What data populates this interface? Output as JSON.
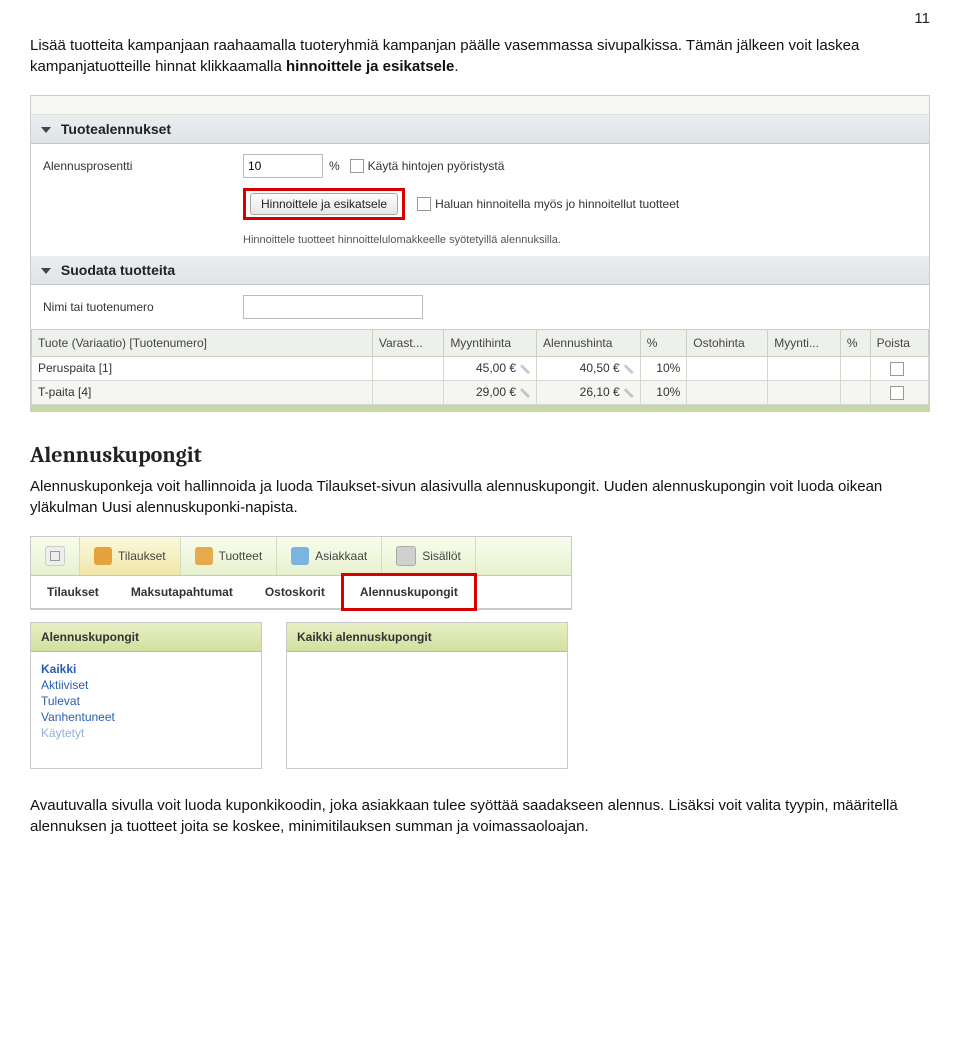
{
  "pageNumber": "11",
  "intro": {
    "line1": "Lisää tuotteita kampanjaan raahaamalla tuoteryhmiä kampanjan päälle vasemmassa sivupalkissa. Tämän jälkeen voit laskea kampanjatuotteille hinnat klikkaamalla ",
    "bold": "hinnoittele ja esikatsele",
    "after": "."
  },
  "panel1": {
    "tuotealennukset": "Tuotealennukset",
    "alennusprosentti_label": "Alennusprosentti",
    "alennusprosentti_value": "10",
    "prosentti": "%",
    "pyoristys": "Käytä hintojen pyöristystä",
    "hinnoittele_btn": "Hinnoittele ja esikatsele",
    "haluan": "Haluan hinnoitella myös jo hinnoitellut tuotteet",
    "hint": "Hinnoittele tuotteet hinnoittelulomakkeelle syötetyillä alennuksilla.",
    "suodata": "Suodata tuotteita",
    "nimi_label": "Nimi tai tuotenumero"
  },
  "table": {
    "h_tuote": "Tuote (Variaatio) [Tuotenumero]",
    "h_varast": "Varast...",
    "h_myyntihinta": "Myyntihinta",
    "h_alennushinta": "Alennushinta",
    "h_pct": "%",
    "h_ostohinta": "Ostohinta",
    "h_myynti": "Myynti...",
    "h_pct2": "%",
    "h_poista": "Poista",
    "rows": [
      {
        "name": "Peruspaita [1]",
        "myyntihinta": "45,00 €",
        "alennushinta": "40,50 €",
        "pct": "10%"
      },
      {
        "name": "T-paita [4]",
        "myyntihinta": "29,00 €",
        "alennushinta": "26,10 €",
        "pct": "10%"
      }
    ]
  },
  "sectionHeading": "Alennuskupongit",
  "sectionPara": "Alennuskuponkeja voit hallinnoida ja luoda Tilaukset-sivun alasivulla alennuskupongit. Uuden alennuskupongin voit luoda oikean yläkulman Uusi alennuskuponki-napista.",
  "tabs": {
    "tilaukset": "Tilaukset",
    "tuotteet": "Tuotteet",
    "asiakkaat": "Asiakkaat",
    "sisallot": "Sisällöt",
    "sub_tilaukset": "Tilaukset",
    "sub_maksu": "Maksutapahtumat",
    "sub_ostoskorit": "Ostoskorit",
    "sub_alennuskupongit": "Alennuskupongit"
  },
  "lists": {
    "left_head": "Alennuskupongit",
    "right_head": "Kaikki alennuskupongit",
    "items": {
      "kaikki": "Kaikki",
      "aktiiviset": "Aktiiviset",
      "tulevat": "Tulevat",
      "vanhentuneet": "Vanhentuneet",
      "kaytetyt": "Käytetyt"
    }
  },
  "closingPara": "Avautuvalla sivulla voit luoda kuponkikoodin, joka asiakkaan tulee syöttää saadakseen alennus. Lisäksi voit valita tyypin, määritellä alennuksen ja tuotteet joita se koskee, minimitilauksen summan ja voimassaoloajan."
}
